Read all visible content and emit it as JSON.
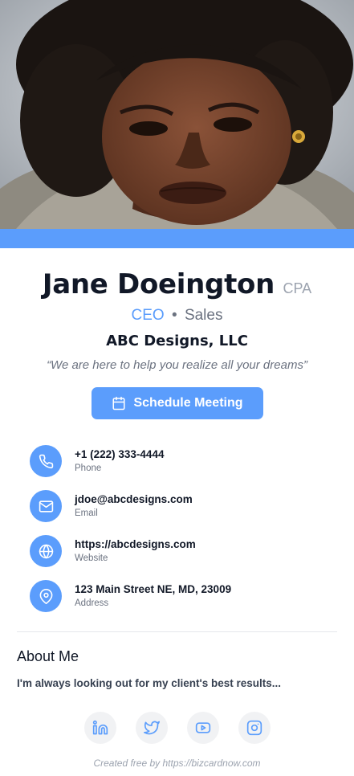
{
  "profile": {
    "name": "Jane Doeington",
    "credential": "CPA",
    "title": "CEO",
    "separator": "•",
    "department": "Sales",
    "company": "ABC Designs, LLC",
    "tagline": "“We are here to help you realize all your dreams”"
  },
  "actions": {
    "schedule_label": "Schedule Meeting"
  },
  "contacts": [
    {
      "value": "+1 (222) 333-4444",
      "label": "Phone",
      "icon": "phone-icon"
    },
    {
      "value": "jdoe@abcdesigns.com",
      "label": "Email",
      "icon": "mail-icon"
    },
    {
      "value": "https://abcdesigns.com",
      "label": "Website",
      "icon": "globe-icon"
    },
    {
      "value": "123 Main Street NE, MD, 23009",
      "label": "Address",
      "icon": "map-pin-icon"
    }
  ],
  "about": {
    "title": "About Me",
    "text": "I'm always looking out for my client's best results..."
  },
  "social": [
    "linkedin-icon",
    "twitter-icon",
    "youtube-icon",
    "instagram-icon"
  ],
  "footer": "Created free by https://bizcardnow.com",
  "colors": {
    "accent": "#5b9dfc",
    "text": "#111827",
    "muted": "#6b7280",
    "social_bg": "#f1f2f4"
  }
}
